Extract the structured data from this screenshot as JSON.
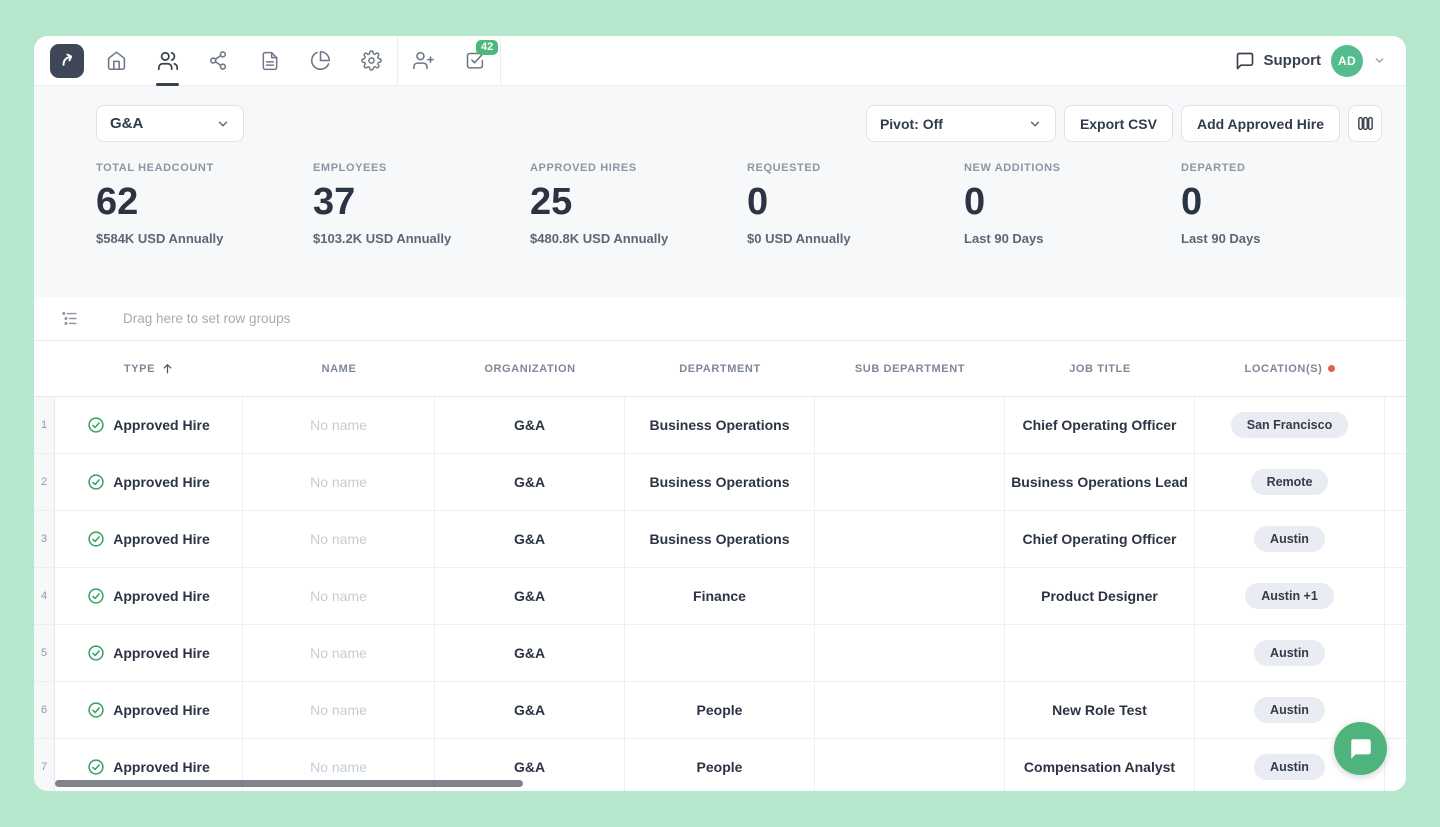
{
  "nav": {
    "icons": [
      "logo-arrow",
      "home",
      "people",
      "org-chart",
      "document",
      "pie-chart",
      "settings",
      "add-person",
      "tasks"
    ],
    "active_tab": "people",
    "tasks_badge": "42",
    "support_label": "Support",
    "avatar_initials": "AD"
  },
  "toolbar": {
    "org_filter_value": "G&A",
    "pivot_value": "Pivot: Off",
    "export_label": "Export CSV",
    "add_hire_label": "Add Approved Hire"
  },
  "stats": [
    {
      "label": "TOTAL HEADCOUNT",
      "value": "62",
      "sub": "$584K USD Annually"
    },
    {
      "label": "EMPLOYEES",
      "value": "37",
      "sub": "$103.2K USD Annually"
    },
    {
      "label": "APPROVED HIRES",
      "value": "25",
      "sub": "$480.8K USD Annually"
    },
    {
      "label": "REQUESTED",
      "value": "0",
      "sub": "$0 USD Annually"
    },
    {
      "label": "NEW ADDITIONS",
      "value": "0",
      "sub": "Last 90 Days"
    },
    {
      "label": "DEPARTED",
      "value": "0",
      "sub": "Last 90 Days"
    }
  ],
  "row_group_bar": {
    "text": "Drag here to set row groups"
  },
  "table": {
    "columns": [
      "Type",
      "Name",
      "Organization",
      "Department",
      "Sub Department",
      "Job Title",
      "Location(s)"
    ],
    "sorted_column": "Type",
    "filtered_column": "Location(s)",
    "rows": [
      {
        "num": "1",
        "type": "Approved Hire",
        "name": "No name",
        "organization": "G&A",
        "department": "Business Operations",
        "sub_department": "",
        "job_title": "Chief Operating Officer",
        "locations": "San Francisco"
      },
      {
        "num": "2",
        "type": "Approved Hire",
        "name": "No name",
        "organization": "G&A",
        "department": "Business Operations",
        "sub_department": "",
        "job_title": "Business Operations Lead",
        "locations": "Remote"
      },
      {
        "num": "3",
        "type": "Approved Hire",
        "name": "No name",
        "organization": "G&A",
        "department": "Business Operations",
        "sub_department": "",
        "job_title": "Chief Operating Officer",
        "locations": "Austin"
      },
      {
        "num": "4",
        "type": "Approved Hire",
        "name": "No name",
        "organization": "G&A",
        "department": "Finance",
        "sub_department": "",
        "job_title": "Product Designer",
        "locations": "Austin +1"
      },
      {
        "num": "5",
        "type": "Approved Hire",
        "name": "No name",
        "organization": "G&A",
        "department": "",
        "sub_department": "",
        "job_title": "",
        "locations": "Austin"
      },
      {
        "num": "6",
        "type": "Approved Hire",
        "name": "No name",
        "organization": "G&A",
        "department": "People",
        "sub_department": "",
        "job_title": "New Role Test",
        "locations": "Austin"
      },
      {
        "num": "7",
        "type": "Approved Hire",
        "name": "No name",
        "organization": "G&A",
        "department": "People",
        "sub_department": "",
        "job_title": "Compensation Analyst",
        "locations": "Austin"
      }
    ]
  },
  "colors": {
    "background": "#b6e8cd",
    "accent_green": "#4db87e",
    "avatar_green": "#55bd8d",
    "check_green": "#35a065",
    "filter_dot_red": "#e0604e",
    "dark_text": "#2c3444",
    "pill_bg": "#e9ecf2"
  }
}
